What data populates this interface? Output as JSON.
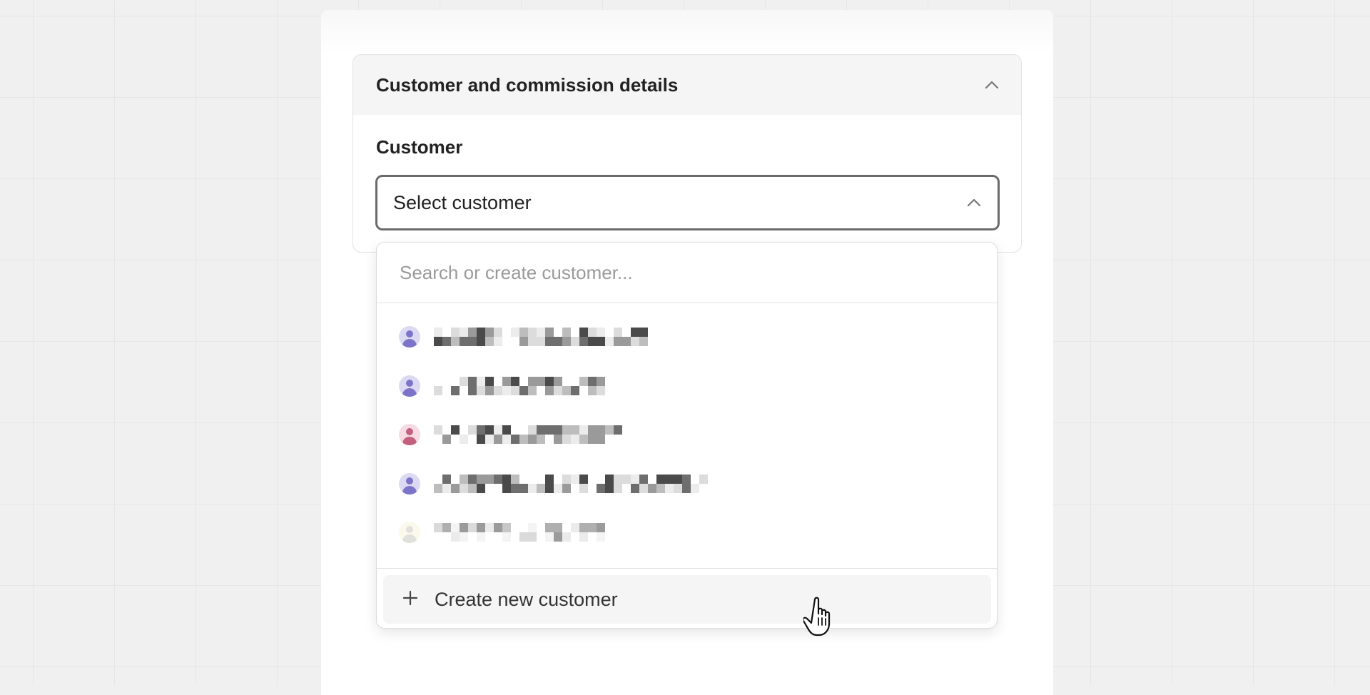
{
  "section": {
    "title": "Customer and commission details",
    "toggle_icon": "chevron-up-icon"
  },
  "customer_field": {
    "label": "Customer",
    "selected_value": "Select customer",
    "toggle_icon": "chevron-up-icon"
  },
  "dropdown": {
    "search_placeholder": "Search or create customer...",
    "items": [
      {
        "avatar_color": "#7b74c9",
        "avatar_bg": "#dcdaf3"
      },
      {
        "avatar_color": "#7b74c9",
        "avatar_bg": "#dcdaf3"
      },
      {
        "avatar_color": "#c2607e",
        "avatar_bg": "#f6dbe4"
      },
      {
        "avatar_color": "#7b74c9",
        "avatar_bg": "#dcdaf3"
      },
      {
        "avatar_color": "#c8c8c0",
        "avatar_bg": "#f7f5dc"
      }
    ],
    "create_label": "Create new customer",
    "create_icon": "plus-icon"
  },
  "colors": {
    "background": "#f0f0f0",
    "panel": "#ffffff",
    "header_bg": "#f5f5f5",
    "border": "#e2e2e2",
    "select_border": "#6b6b6b",
    "text": "#222222"
  }
}
